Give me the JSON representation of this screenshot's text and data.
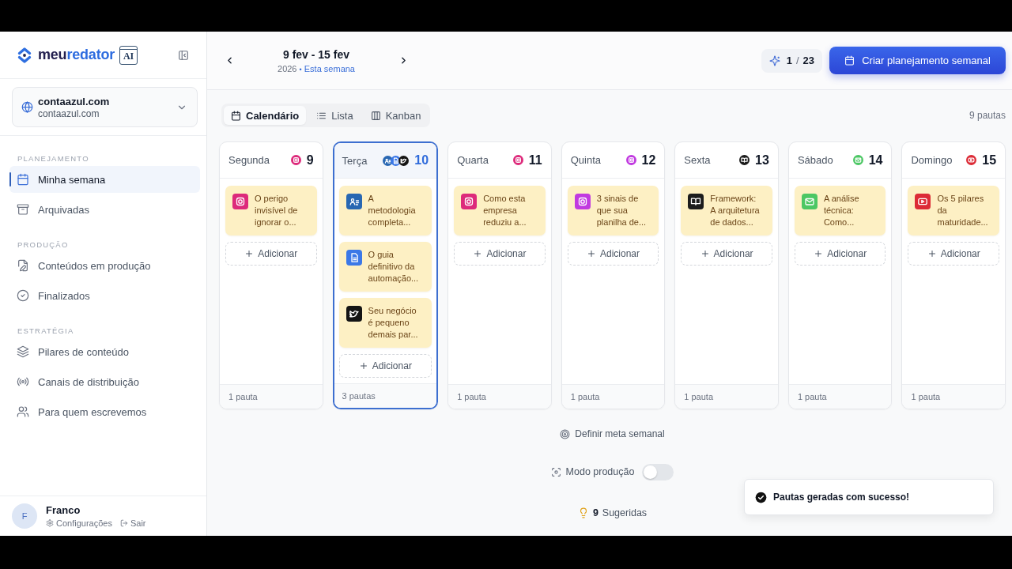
{
  "sidebar": {
    "logo": {
      "prefix": "meu",
      "suffix": "redator",
      "badge": "AI"
    },
    "site": {
      "name": "contaazul.com",
      "domain": "contaazul.com"
    },
    "sections": [
      {
        "heading": "PLANEJAMENTO",
        "items": [
          {
            "label": "Minha semana",
            "selected": true
          },
          {
            "label": "Arquivadas",
            "selected": false
          }
        ]
      },
      {
        "heading": "PRODUÇÃO",
        "items": [
          {
            "label": "Conteúdos em produção",
            "selected": false
          },
          {
            "label": "Finalizados",
            "selected": false
          }
        ]
      },
      {
        "heading": "ESTRATÉGIA",
        "items": [
          {
            "label": "Pilares de conteúdo",
            "selected": false
          },
          {
            "label": "Canais de distribuição",
            "selected": false
          },
          {
            "label": "Para quem escrevemos",
            "selected": false
          }
        ]
      }
    ],
    "user": {
      "initial": "F",
      "name": "Franco",
      "settings": "Configurações",
      "logout": "Sair"
    }
  },
  "header": {
    "week": {
      "range": "9 fev - 15 fev",
      "year": "2026",
      "separator": "•",
      "current": "Esta semana"
    },
    "credits": {
      "used": "1",
      "separator": "/",
      "total": "23"
    },
    "create_button": "Criar planejamento semanal"
  },
  "view_tabs": [
    {
      "label": "Calendário",
      "selected": true
    },
    {
      "label": "Lista",
      "selected": false
    },
    {
      "label": "Kanban",
      "selected": false
    }
  ],
  "total": "9 pautas",
  "days": [
    {
      "name": "Segunda",
      "number": "9",
      "selected": false,
      "cards": [
        {
          "title": "O perigo invisível de ignorar o...",
          "kind": "camera",
          "color": "#dd2a7b"
        }
      ],
      "add_label": "Adicionar",
      "count": "1 pauta"
    },
    {
      "name": "Terça",
      "number": "10",
      "selected": true,
      "cards": [
        {
          "title": "A metodologia completa...",
          "kind": "profile",
          "color": "#2867b2"
        },
        {
          "title": "O guia definitivo da automação...",
          "kind": "document",
          "color": "#3b78e7"
        },
        {
          "title": "Seu negócio é pequeno demais par...",
          "kind": "bird",
          "color": "#141414"
        }
      ],
      "add_label": "Adicionar",
      "count": "3 pautas"
    },
    {
      "name": "Quarta",
      "number": "11",
      "selected": false,
      "cards": [
        {
          "title": "Como esta empresa reduziu a...",
          "kind": "camera",
          "color": "#dd2a7b"
        }
      ],
      "add_label": "Adicionar",
      "count": "1 pauta"
    },
    {
      "name": "Quinta",
      "number": "12",
      "selected": false,
      "cards": [
        {
          "title": "3 sinais de que sua planilha de...",
          "kind": "camera",
          "color": "#c13ae0"
        }
      ],
      "add_label": "Adicionar",
      "count": "1 pauta"
    },
    {
      "name": "Sexta",
      "number": "13",
      "selected": false,
      "cards": [
        {
          "title": "Framework: A arquitetura de dados...",
          "kind": "book",
          "color": "#1c1c1c"
        }
      ],
      "add_label": "Adicionar",
      "count": "1 pauta"
    },
    {
      "name": "Sábado",
      "number": "14",
      "selected": false,
      "cards": [
        {
          "title": "A análise técnica: Como...",
          "kind": "mail",
          "color": "#4cc764"
        }
      ],
      "add_label": "Adicionar",
      "count": "1 pauta"
    },
    {
      "name": "Domingo",
      "number": "15",
      "selected": false,
      "cards": [
        {
          "title": "Os 5 pilares da maturidade...",
          "kind": "play",
          "color": "#dc2b36"
        }
      ],
      "add_label": "Adicionar",
      "count": "1 pauta"
    }
  ],
  "goal": {
    "label": "Definir meta semanal"
  },
  "production_mode": {
    "label": "Modo produção",
    "on": false
  },
  "suggestions": {
    "count": "9",
    "label": "Sugeridas"
  },
  "toast": {
    "message": "Pautas geradas com sucesso!"
  }
}
